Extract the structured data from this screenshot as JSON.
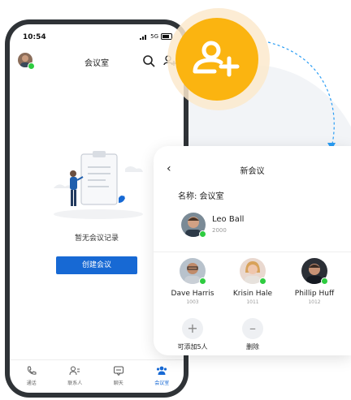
{
  "phone": {
    "time": "10:54",
    "network": "5G",
    "title": "会议室",
    "empty_text": "暂无会议记录",
    "create_button": "创建会议",
    "tabs": [
      {
        "label": "通话",
        "icon": "phone-icon"
      },
      {
        "label": "联系人",
        "icon": "contacts-icon"
      },
      {
        "label": "聊天",
        "icon": "chat-icon"
      },
      {
        "label": "会议室",
        "icon": "meeting-icon",
        "active": true
      }
    ]
  },
  "card": {
    "title": "新会议",
    "name_label": "名称: 会议室",
    "host": {
      "name": "Leo Ball",
      "number": "2000"
    },
    "members": [
      {
        "name": "Dave Harris",
        "number": "1003"
      },
      {
        "name": "Krisin Hale",
        "number": "1011"
      },
      {
        "name": "Phillip Huff",
        "number": "1012"
      }
    ],
    "add_label": "可添加5人",
    "delete_label": "删除"
  },
  "colors": {
    "accent": "#1769d4",
    "badge": "#fbb410",
    "online": "#2ecc40"
  }
}
